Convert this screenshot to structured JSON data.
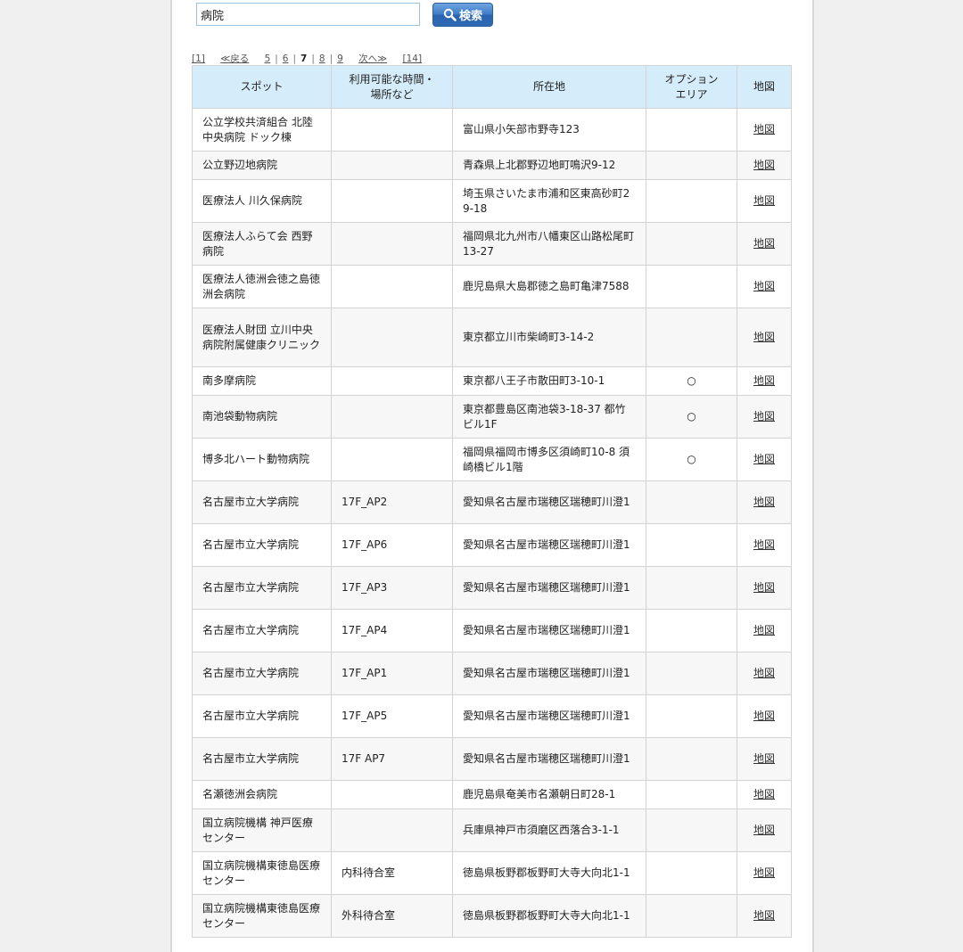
{
  "search": {
    "value": "病院",
    "button_label": "検索"
  },
  "pager": {
    "first": "[1]",
    "prev": "≪戻る",
    "pages": [
      "5",
      "6",
      "7",
      "8",
      "9"
    ],
    "current": "7",
    "next": "次へ≫",
    "last": "[14]"
  },
  "table": {
    "headers": {
      "spot": "スポット",
      "time_place_1": "利用可能な時間・",
      "time_place_2": "場所など",
      "address": "所在地",
      "option_1": "オプション",
      "option_2": "エリア",
      "map": "地図"
    },
    "rows": [
      {
        "spot": "公立学校共済組合 北陸中央病院 ドック棟",
        "time": "",
        "address": "富山県小矢部市野寺123",
        "option": "",
        "map": "地図"
      },
      {
        "spot": "公立野辺地病院",
        "time": "",
        "address": "青森県上北郡野辺地町鳴沢9-12",
        "option": "",
        "map": "地図"
      },
      {
        "spot": "医療法人 川久保病院",
        "time": "",
        "address": "埼玉県さいたま市浦和区東高砂町29-18",
        "option": "",
        "map": "地図"
      },
      {
        "spot": "医療法人ふらて会 西野病院",
        "time": "",
        "address": "福岡県北九州市八幡東区山路松尾町13-27",
        "option": "",
        "map": "地図"
      },
      {
        "spot": "医療法人徳洲会徳之島徳洲会病院",
        "time": "",
        "address": "鹿児島県大島郡徳之島町亀津7588",
        "option": "",
        "map": "地図"
      },
      {
        "spot": "医療法人財団 立川中央病院附属健康クリニック",
        "time": "",
        "address": "東京都立川市柴崎町3-14-2",
        "option": "",
        "map": "地図"
      },
      {
        "spot": "南多摩病院",
        "time": "",
        "address": "東京都八王子市散田町3-10-1",
        "option": "○",
        "map": "地図"
      },
      {
        "spot": "南池袋動物病院",
        "time": "",
        "address": "東京都豊島区南池袋3-18-37 都竹ビル1F",
        "option": "○",
        "map": "地図"
      },
      {
        "spot": "博多北ハート動物病院",
        "time": "",
        "address": "福岡県福岡市博多区須崎町10-8 須崎橋ビル1階",
        "option": "○",
        "map": "地図"
      },
      {
        "spot": "名古屋市立大学病院",
        "time": "17F_AP2",
        "address": "愛知県名古屋市瑞穂区瑞穂町川澄1",
        "option": "",
        "map": "地図"
      },
      {
        "spot": "名古屋市立大学病院",
        "time": "17F_AP6",
        "address": "愛知県名古屋市瑞穂区瑞穂町川澄1",
        "option": "",
        "map": "地図"
      },
      {
        "spot": "名古屋市立大学病院",
        "time": "17F_AP3",
        "address": "愛知県名古屋市瑞穂区瑞穂町川澄1",
        "option": "",
        "map": "地図"
      },
      {
        "spot": "名古屋市立大学病院",
        "time": "17F_AP4",
        "address": "愛知県名古屋市瑞穂区瑞穂町川澄1",
        "option": "",
        "map": "地図"
      },
      {
        "spot": "名古屋市立大学病院",
        "time": "17F_AP1",
        "address": "愛知県名古屋市瑞穂区瑞穂町川澄1",
        "option": "",
        "map": "地図"
      },
      {
        "spot": "名古屋市立大学病院",
        "time": "17F_AP5",
        "address": "愛知県名古屋市瑞穂区瑞穂町川澄1",
        "option": "",
        "map": "地図"
      },
      {
        "spot": "名古屋市立大学病院",
        "time": "17F AP7",
        "address": "愛知県名古屋市瑞穂区瑞穂町川澄1",
        "option": "",
        "map": "地図"
      },
      {
        "spot": "名瀬徳洲会病院",
        "time": "",
        "address": "鹿児島県奄美市名瀬朝日町28-1",
        "option": "",
        "map": "地図"
      },
      {
        "spot": "国立病院機構 神戸医療センター",
        "time": "",
        "address": "兵庫県神戸市須磨区西落合3-1-1",
        "option": "",
        "map": "地図"
      },
      {
        "spot": "国立病院機構東徳島医療センター",
        "time": "内科待合室",
        "address": "徳島県板野郡板野町大寺大向北1-1",
        "option": "",
        "map": "地図"
      },
      {
        "spot": "国立病院機構東徳島医療センター",
        "time": "外科待合室",
        "address": "徳島県板野郡板野町大寺大向北1-1",
        "option": "",
        "map": "地図"
      }
    ]
  }
}
